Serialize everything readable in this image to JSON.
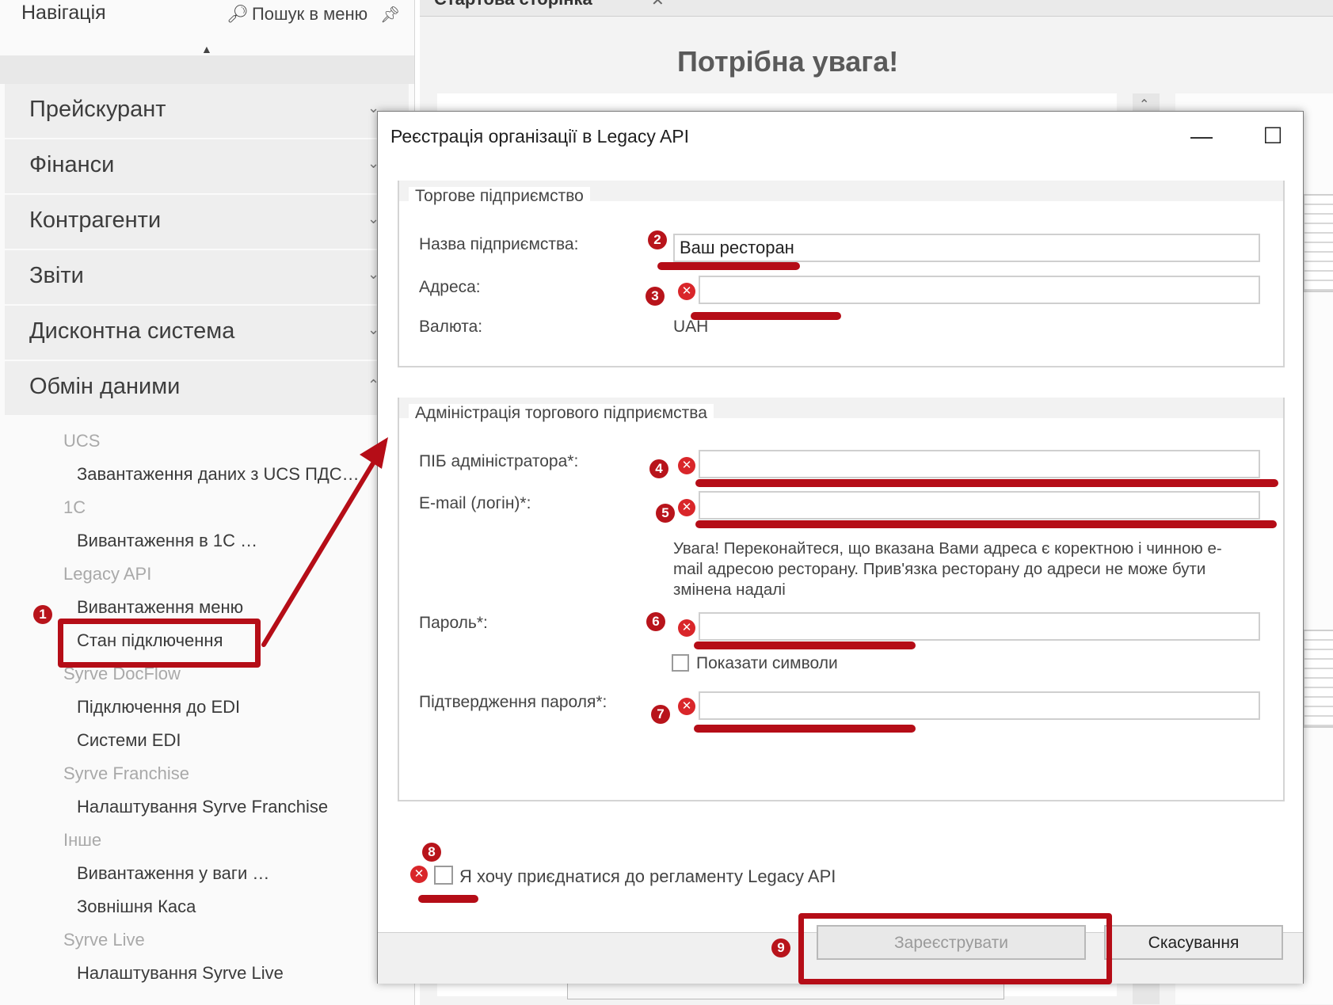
{
  "nav": {
    "title": "Навігація",
    "search_label": "Пошук в меню",
    "pin_icon": "pin-icon",
    "groups": [
      {
        "label": "Прейскурант"
      },
      {
        "label": "Фінанси"
      },
      {
        "label": "Контрагенти"
      },
      {
        "label": "Звіти"
      },
      {
        "label": "Дисконтна система"
      },
      {
        "label": "Обмін даними"
      }
    ],
    "sections": [
      {
        "header": "UCS",
        "items": [
          "Завантаження даних з UCS ПДС…"
        ]
      },
      {
        "header": "1С",
        "items": [
          "Вивантаження в 1С …"
        ]
      },
      {
        "header": "Legacy API",
        "items": [
          "Вивантаження меню",
          "Стан підключення"
        ]
      },
      {
        "header": "Syrve DocFlow",
        "items": [
          "Підключення до EDI",
          "Системи EDI"
        ]
      },
      {
        "header": "Syrve Franchise",
        "items": [
          "Налаштування Syrve Franchise"
        ]
      },
      {
        "header": "Інше",
        "items": [
          "Вивантаження у ваги …",
          "Зовнішня Каса"
        ]
      },
      {
        "header": "Syrve Live",
        "items": [
          "Налаштування Syrve Live"
        ]
      }
    ]
  },
  "page": {
    "tab_label": "Стартова сторінка",
    "attention": "Потрібна увага!"
  },
  "dialog": {
    "title": "Реєстрація організації в Legacy API",
    "group1": {
      "legend": "Торгове підприємство",
      "name_label": "Назва підприємства:",
      "name_value": "Ваш ресторан",
      "address_label": "Адреса:",
      "address_value": "",
      "currency_label": "Валюта:",
      "currency_value": "UAH"
    },
    "group2": {
      "legend": "Адміністрація торгового підприємства",
      "admin_label": "ПІБ адміністратора*:",
      "email_label": "E-mail (логін)*:",
      "warning": "Увага! Переконайтеся, що вказана Вами адреса є коректною і чинною e-mail адресою ресторану. Прив'язка ресторану до адреси не може бути змінена надалі",
      "password_label": "Пароль*:",
      "show_symbols_label": "Показати символи",
      "confirm_label": "Підтвердження пароля*:"
    },
    "agree_label": "Я хочу приєднатися до регламенту Legacy API",
    "register_button": "Зареєструвати",
    "cancel_button": "Скасування"
  },
  "annotations": {
    "badges": [
      "1",
      "2",
      "3",
      "4",
      "5",
      "6",
      "7",
      "8",
      "9"
    ],
    "accent_color": "#b50d17"
  }
}
